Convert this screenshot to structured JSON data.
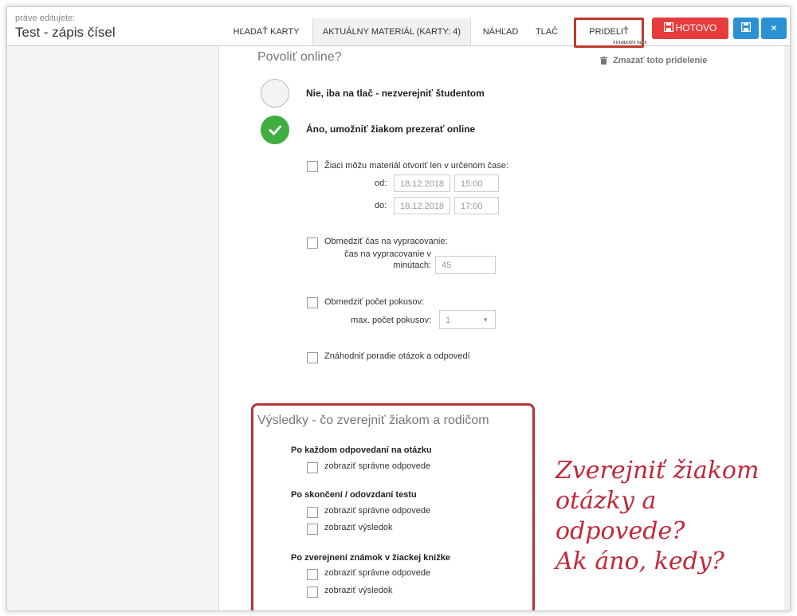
{
  "header": {
    "editing_label": "práve editujete:",
    "title": "Test - zápis čísel",
    "tabs": [
      "HĽADAŤ KARTY",
      "AKTUÁLNY MATERIÁL (KARTY: 4)",
      "NÁHĽAD",
      "TLAČ",
      "PRIDELIŤ"
    ],
    "done_button": "HOTOVO",
    "close_button": "×",
    "icons": {
      "done": "save-icon",
      "save": "save-icon",
      "close": "close-icon"
    },
    "colors": {
      "done": "#e83b3b",
      "save": "#2a92d4",
      "highlight": "#c0392b"
    }
  },
  "side": {
    "partial_link": "materiál",
    "delete_link": "Zmazať toto pridelenie",
    "delete_icon": "trash-icon"
  },
  "online": {
    "title": "Povoliť online?",
    "option_no": "Nie, iba na tlač - nezverejniť študentom",
    "option_yes": "Áno, umožniť žiakom prezerať online",
    "selected": "yes",
    "time_window": {
      "label": "Žiaci môžu materiál otvoriť len v určenom čase:",
      "from_label": "od:",
      "from_date": "18.12.2018",
      "from_time": "15:00",
      "to_label": "do:",
      "to_date": "18.12.2018",
      "to_time": "17:00"
    },
    "limit_time": {
      "label": "Obmedziť čas na vypracovanie:",
      "field_label_line1": "čas na vypracovanie v",
      "field_label_line2": "minútach:",
      "value": "45"
    },
    "limit_attempts": {
      "label": "Obmedziť počet pokusov:",
      "field_label": "max. počet pokusov:",
      "value": "1"
    },
    "shuffle": {
      "label": "Znáhodniť poradie otázok a odpovedí"
    }
  },
  "results": {
    "title": "Výsledky - čo zverejniť žiakom a rodičom",
    "groups": [
      {
        "title": "Po každom odpovedaní na otázku",
        "options": [
          "zobraziť správne odpovede"
        ]
      },
      {
        "title": "Po skončení / odovzdaní testu",
        "options": [
          "zobraziť správne odpovede",
          "zobraziť výsledok"
        ]
      },
      {
        "title": "Po zverejnení známok v žiackej knižke",
        "options": [
          "zobraziť správne odpovede",
          "zobraziť výsledok"
        ]
      }
    ]
  },
  "annotation": {
    "line1": "Zverejniť žiakom",
    "line2": "otázky a odpovede?",
    "line3": "Ak áno, kedy?"
  }
}
